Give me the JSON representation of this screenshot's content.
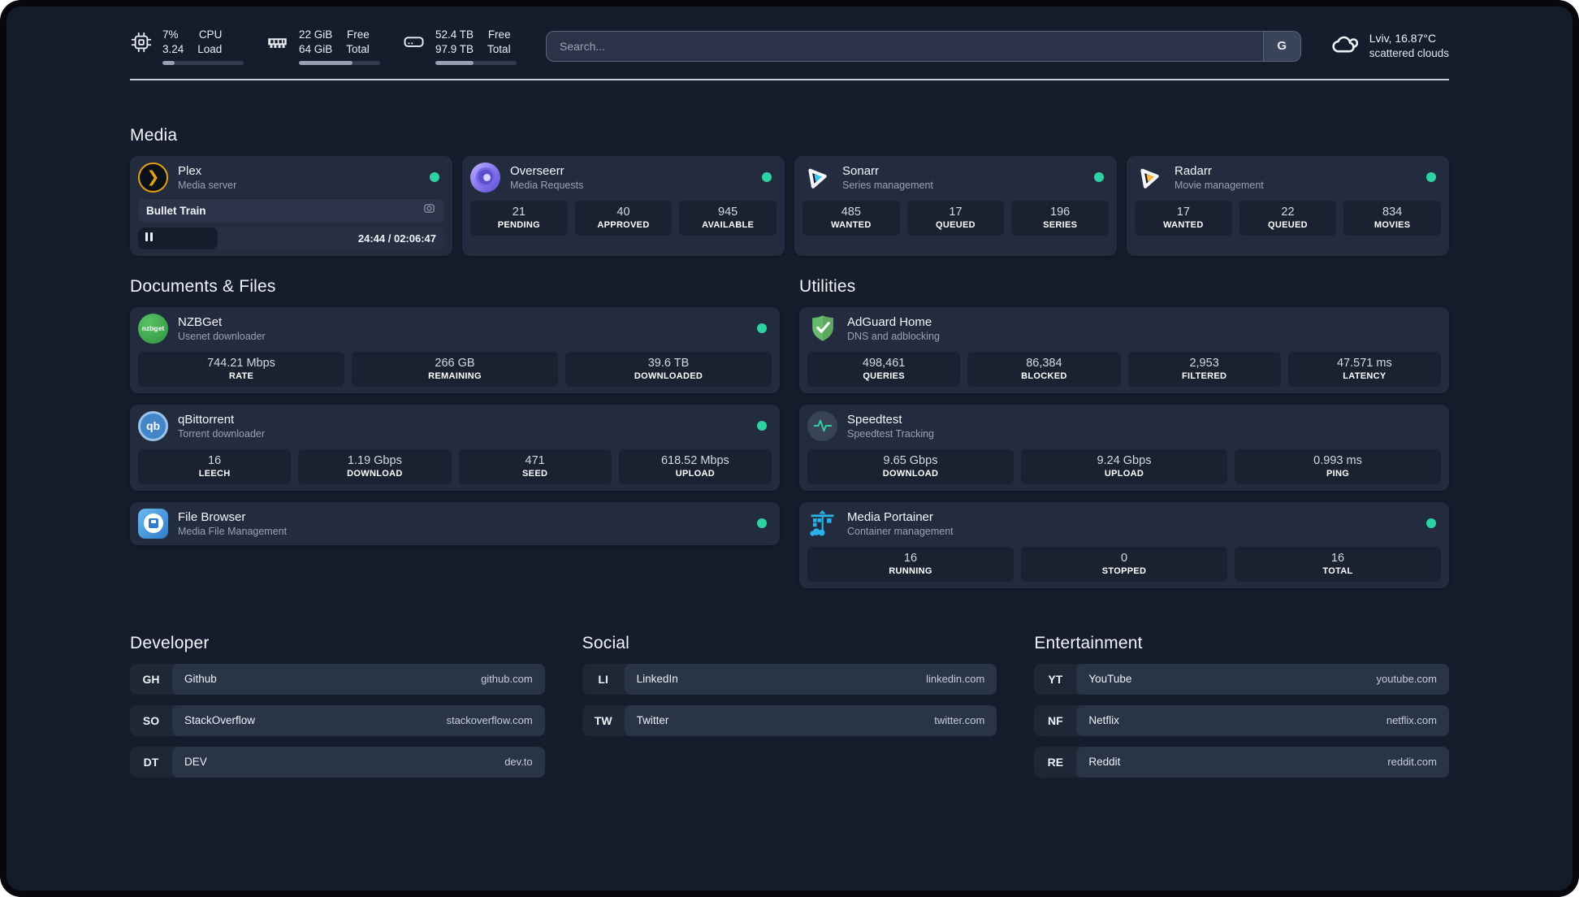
{
  "colors": {
    "background": "#151c2b",
    "card": "#232c3e",
    "status_green": "#2ed3a4",
    "accent_plex": "#e5a00d",
    "accent_sonarr": "#38c6f4",
    "accent_radarr": "#ffb53c",
    "accent_portainer": "#29b2e8"
  },
  "header": {
    "resources": [
      {
        "icon": "cpu-icon",
        "values": [
          "7%",
          "3.24"
        ],
        "labels": [
          "CPU",
          "Load"
        ],
        "progress_pct": 15
      },
      {
        "icon": "ram-icon",
        "values": [
          "22 GiB",
          "64 GiB"
        ],
        "labels": [
          "Free",
          "Total"
        ],
        "progress_pct": 66
      },
      {
        "icon": "disk-icon",
        "values": [
          "52.4 TB",
          "97.9 TB"
        ],
        "labels": [
          "Free",
          "Total"
        ],
        "progress_pct": 47
      }
    ],
    "search": {
      "placeholder": "Search...",
      "engine_label": "G"
    },
    "weather": {
      "location_temp": "Lviv, 16.87°C",
      "condition": "scattered clouds"
    }
  },
  "sections": {
    "media": {
      "title": "Media",
      "cards": [
        {
          "title": "Plex",
          "subtitle": "Media server",
          "status": "online",
          "player": {
            "track": "Bullet Train",
            "time": "24:44 / 02:06:47",
            "progress_pct": 26
          }
        },
        {
          "title": "Overseerr",
          "subtitle": "Media Requests",
          "status": "online",
          "stats": [
            {
              "value": "21",
              "label": "PENDING"
            },
            {
              "value": "40",
              "label": "APPROVED"
            },
            {
              "value": "945",
              "label": "AVAILABLE"
            }
          ]
        },
        {
          "title": "Sonarr",
          "subtitle": "Series management",
          "status": "online",
          "stats": [
            {
              "value": "485",
              "label": "WANTED"
            },
            {
              "value": "17",
              "label": "QUEUED"
            },
            {
              "value": "196",
              "label": "SERIES"
            }
          ]
        },
        {
          "title": "Radarr",
          "subtitle": "Movie management",
          "status": "online",
          "stats": [
            {
              "value": "17",
              "label": "WANTED"
            },
            {
              "value": "22",
              "label": "QUEUED"
            },
            {
              "value": "834",
              "label": "MOVIES"
            }
          ]
        }
      ]
    },
    "documents": {
      "title": "Documents & Files",
      "cards": [
        {
          "title": "NZBGet",
          "subtitle": "Usenet downloader",
          "status": "online",
          "stats": [
            {
              "value": "744.21 Mbps",
              "label": "RATE"
            },
            {
              "value": "266 GB",
              "label": "REMAINING"
            },
            {
              "value": "39.6 TB",
              "label": "DOWNLOADED"
            }
          ]
        },
        {
          "title": "qBittorrent",
          "subtitle": "Torrent downloader",
          "status": "online",
          "stats": [
            {
              "value": "16",
              "label": "LEECH"
            },
            {
              "value": "1.19 Gbps",
              "label": "DOWNLOAD"
            },
            {
              "value": "471",
              "label": "SEED"
            },
            {
              "value": "618.52 Mbps",
              "label": "UPLOAD"
            }
          ]
        },
        {
          "title": "File Browser",
          "subtitle": "Media File Management",
          "status": "online"
        }
      ]
    },
    "utilities": {
      "title": "Utilities",
      "cards": [
        {
          "title": "AdGuard Home",
          "subtitle": "DNS and adblocking",
          "status": "none",
          "stats": [
            {
              "value": "498,461",
              "label": "QUERIES"
            },
            {
              "value": "86,384",
              "label": "BLOCKED"
            },
            {
              "value": "2,953",
              "label": "FILTERED"
            },
            {
              "value": "47.571 ms",
              "label": "LATENCY"
            }
          ]
        },
        {
          "title": "Speedtest",
          "subtitle": "Speedtest Tracking",
          "status": "none",
          "stats": [
            {
              "value": "9.65 Gbps",
              "label": "DOWNLOAD"
            },
            {
              "value": "9.24 Gbps",
              "label": "UPLOAD"
            },
            {
              "value": "0.993 ms",
              "label": "PING"
            }
          ]
        },
        {
          "title": "Media Portainer",
          "subtitle": "Container management",
          "status": "online",
          "stats": [
            {
              "value": "16",
              "label": "RUNNING"
            },
            {
              "value": "0",
              "label": "STOPPED"
            },
            {
              "value": "16",
              "label": "TOTAL"
            }
          ]
        }
      ]
    },
    "bookmarks": [
      {
        "title": "Developer",
        "links": [
          {
            "abbr": "GH",
            "name": "Github",
            "url": "github.com"
          },
          {
            "abbr": "SO",
            "name": "StackOverflow",
            "url": "stackoverflow.com"
          },
          {
            "abbr": "DT",
            "name": "DEV",
            "url": "dev.to"
          }
        ]
      },
      {
        "title": "Social",
        "links": [
          {
            "abbr": "LI",
            "name": "LinkedIn",
            "url": "linkedin.com"
          },
          {
            "abbr": "TW",
            "name": "Twitter",
            "url": "twitter.com"
          }
        ]
      },
      {
        "title": "Entertainment",
        "links": [
          {
            "abbr": "YT",
            "name": "YouTube",
            "url": "youtube.com"
          },
          {
            "abbr": "NF",
            "name": "Netflix",
            "url": "netflix.com"
          },
          {
            "abbr": "RE",
            "name": "Reddit",
            "url": "reddit.com"
          }
        ]
      }
    ]
  }
}
